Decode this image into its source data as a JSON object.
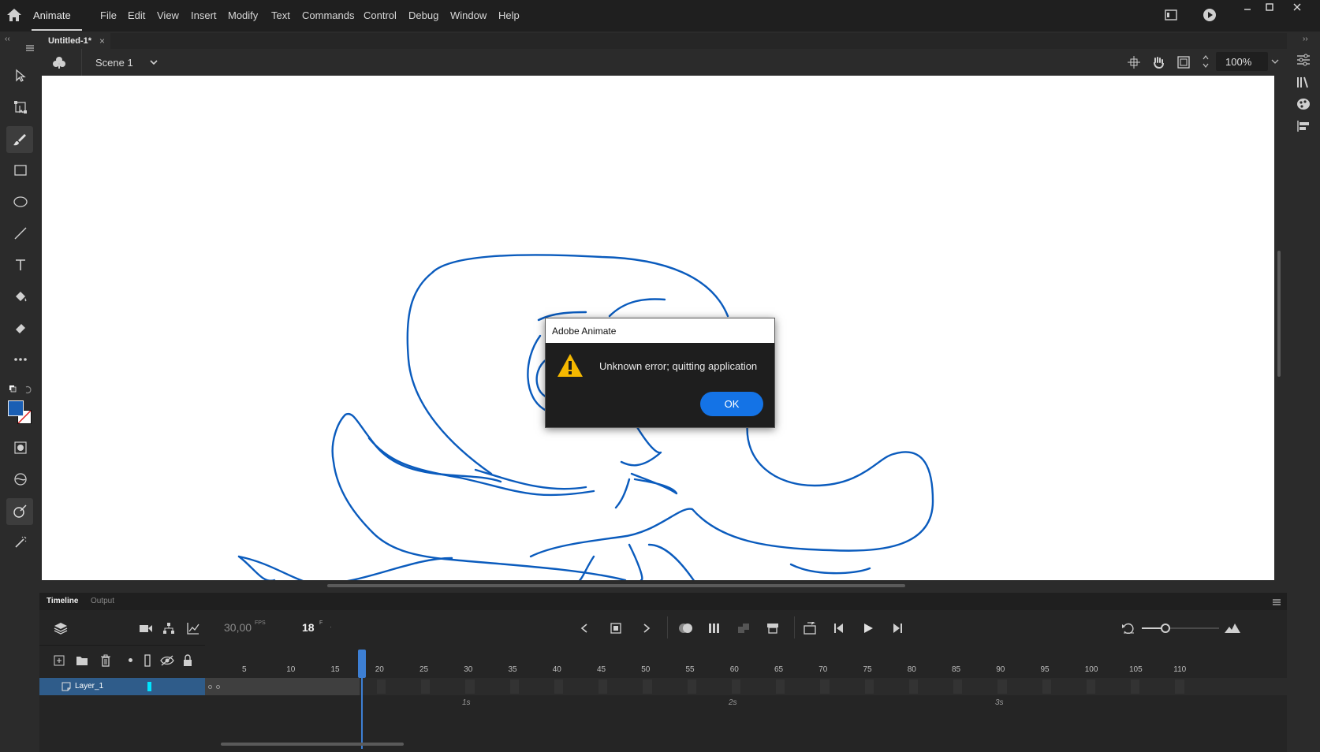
{
  "app": {
    "name": "Animate"
  },
  "menu": [
    "File",
    "Edit",
    "View",
    "Insert",
    "Modify",
    "Text",
    "Commands",
    "Control",
    "Debug",
    "Window",
    "Help"
  ],
  "document": {
    "tab_title": "Untitled-1*",
    "close_glyph": "×",
    "scene": "Scene 1",
    "zoom": "100%"
  },
  "timeline": {
    "tabs": [
      "Timeline",
      "Output"
    ],
    "fps": "30,00",
    "fps_unit": "FPS",
    "frame": "18",
    "frame_unit": "F",
    "ruler_numbers": [
      "5",
      "10",
      "15",
      "20",
      "25",
      "30",
      "35",
      "40",
      "45",
      "50",
      "55",
      "60",
      "65",
      "70",
      "75",
      "80",
      "85",
      "90",
      "95",
      "100",
      "105",
      "110"
    ],
    "seconds": [
      "1s",
      "2s",
      "3s"
    ],
    "layer": {
      "name": "Layer_1",
      "color": "#00e5ff"
    },
    "playhead_frame": 18
  },
  "dialog": {
    "title": "Adobe Animate",
    "message": "Unknown error; quitting application",
    "ok_label": "OK"
  },
  "colors": {
    "accent": "#1473e6",
    "stroke_color": "#1a5fb4",
    "fill_color": "#ffffff",
    "drawing": "#0a5bbd",
    "warning": "#f5b800",
    "layer_selected": "#2f5c8a"
  }
}
